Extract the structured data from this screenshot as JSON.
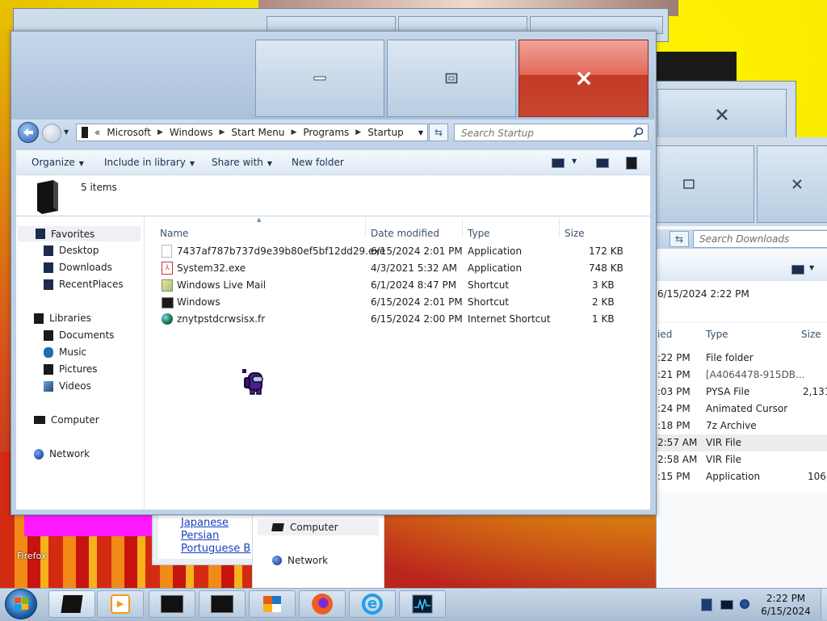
{
  "main_window": {
    "caption": {
      "minimize": "–",
      "maximize": "□",
      "close": "✕"
    },
    "address": {
      "overflow": "«",
      "crumbs": [
        "Microsoft",
        "Windows",
        "Start Menu",
        "Programs",
        "Startup"
      ]
    },
    "search": {
      "placeholder": "Search Startup"
    },
    "toolbar": {
      "organize": "Organize",
      "include_in_library": "Include in library",
      "share_with": "Share with",
      "new_folder": "New folder"
    },
    "item_count": "5 items",
    "nav": {
      "favorites": "Favorites",
      "desktop": "Desktop",
      "downloads": "Downloads",
      "recent": "RecentPlaces",
      "libraries": "Libraries",
      "documents": "Documents",
      "music": "Music",
      "pictures": "Pictures",
      "videos": "Videos",
      "computer": "Computer",
      "network": "Network"
    },
    "columns": {
      "name": "Name",
      "date": "Date modified",
      "type": "Type",
      "size": "Size"
    },
    "files": [
      {
        "name": "7437af787b737d9e39b80ef5bf12dd29.exe",
        "date": "6/15/2024 2:01 PM",
        "type": "Application",
        "size": "172 KB",
        "icon": "blank-file-icon"
      },
      {
        "name": "System32.exe",
        "date": "4/3/2021 5:32 AM",
        "type": "Application",
        "size": "748 KB",
        "icon": "pdf-icon"
      },
      {
        "name": "Windows Live Mail",
        "date": "6/1/2024 8:47 PM",
        "type": "Shortcut",
        "size": "3 KB",
        "icon": "mail-icon"
      },
      {
        "name": "Windows",
        "date": "6/15/2024 2:01 PM",
        "type": "Shortcut",
        "size": "2 KB",
        "icon": "console-icon"
      },
      {
        "name": "znytpstdcrwsisx.fr",
        "date": "6/15/2024 2:00 PM",
        "type": "Internet Shortcut",
        "size": "1 KB",
        "icon": "globe-icon"
      }
    ]
  },
  "downloads_window": {
    "search": {
      "placeholder": "Search Downloads"
    },
    "date_header": "6/15/2024 2:22 PM",
    "columns": {
      "date_fragment": "ied",
      "type": "Type",
      "size": "Size"
    },
    "rows": [
      {
        "time": ":22 PM",
        "type": "File folder",
        "size": ""
      },
      {
        "time": ":21 PM",
        "type": "[A4064478-915DB...",
        "size": ""
      },
      {
        "time": ":03 PM",
        "type": "PYSA File",
        "size": "2,131,"
      },
      {
        "time": ":24 PM",
        "type": "Animated Cursor",
        "size": ""
      },
      {
        "time": ":18 PM",
        "type": "7z Archive",
        "size": ""
      },
      {
        "time": "2:57 AM",
        "type": "VIR File",
        "size": ""
      },
      {
        "time": "2:58 AM",
        "type": "VIR File",
        "size": ""
      },
      {
        "time": ":15 PM",
        "type": "Application",
        "size": "106,"
      }
    ]
  },
  "language_window": {
    "links": [
      "Japanese",
      "Persian",
      "Portuguese B"
    ]
  },
  "behind_nav": {
    "computer": "Computer",
    "network": "Network"
  },
  "desktop": {
    "firefox_label": "Firefox"
  },
  "taskbar": {
    "time": "2:22 PM",
    "date": "6/15/2024"
  }
}
